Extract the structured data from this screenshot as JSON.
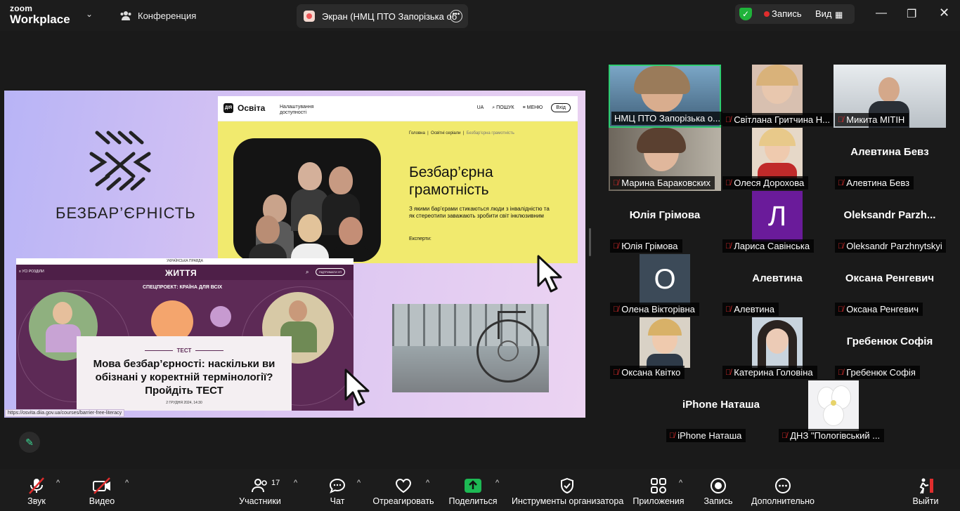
{
  "topbar": {
    "logo_line1": "zoom",
    "logo_line2": "Workplace",
    "conference_label": "Конференция",
    "share_tab_title": "Экран (НМЦ ПТО Запорізька об",
    "record_label": "Запись",
    "view_label": "Вид"
  },
  "slide": {
    "logo_text": "БЕЗБАР’ЄРНІСТЬ",
    "osvita": {
      "logo": "Освіта",
      "dia": "ДІЯ",
      "accessibility": "Налаштування доступності",
      "nav_ua": "UA",
      "nav_search": "ПОШУК",
      "nav_menu": "МЕНЮ",
      "nav_login": "Вхід",
      "breadcrumb_home": "Головна",
      "breadcrumb_series": "Освітні серіали",
      "breadcrumb_current": "Безбар'єрна грамотність",
      "title_line1": "Безбар’єрна",
      "title_line2": "грамотність",
      "subtitle": "З якими бар'єрами стикаються люди з інвалідністю та як стереотипи заважають зробити світ інклюзивним",
      "experts": "Експерти:"
    },
    "zhyttia": {
      "top_label": "УКРАЇНСЬКА ПРАВДА",
      "menu_label": "УСІ РОЗДІЛИ",
      "logo": "ЖИТТЯ",
      "support": "ПІДТРИМАТИ УП",
      "special": "СПЕЦПРОЕКТ: КРАЇНА ДЛЯ ВСІХ",
      "test_label": "ТЕСТ",
      "headline": "Мова безбар’єрності: наскільки ви обізнані у коректній термінології? Пройдіть ТЕСТ",
      "date": "2 ГРУДНЯ 2024, 14:30"
    },
    "url": "https://osvita.diia.gov.ua/courses/barrier-free-literacy"
  },
  "participants": [
    {
      "tile_name": "НМЦ ПТО Запорізька о...",
      "muted": false,
      "type": "video",
      "active": true
    },
    {
      "tile_name": "Світлана Гритчина Н...",
      "muted": true,
      "type": "photo"
    },
    {
      "tile_name": "Микита МІТІН",
      "muted": true,
      "type": "video"
    },
    {
      "tile_name": "Марина Бараковских",
      "muted": true,
      "type": "video"
    },
    {
      "tile_name": "Олеся Дорохова",
      "muted": true,
      "type": "photo"
    },
    {
      "tile_name": "Алевтина Бевз",
      "big_name": "Алевтина Бевз",
      "muted": true,
      "type": "name"
    },
    {
      "tile_name": "Юлія Грімова",
      "big_name": "Юлія Грімова",
      "muted": true,
      "type": "name"
    },
    {
      "tile_name": "Лариса Савінська",
      "muted": true,
      "type": "letter",
      "letter": "Л"
    },
    {
      "tile_name": "Oleksandr Parzhnytskyi",
      "big_name": "Oleksandr  Parzh...",
      "muted": true,
      "type": "name"
    },
    {
      "tile_name": "Олена Вікторівна",
      "muted": true,
      "type": "letter",
      "letter": "О"
    },
    {
      "tile_name": "Алевтина",
      "big_name": "Алевтина",
      "muted": true,
      "type": "name"
    },
    {
      "tile_name": "Оксана Ренгевич",
      "big_name": "Оксана Ренгевич",
      "muted": true,
      "type": "name"
    },
    {
      "tile_name": "Оксана Квітко",
      "muted": true,
      "type": "photo"
    },
    {
      "tile_name": "Катерина Головіна",
      "muted": true,
      "type": "photo"
    },
    {
      "tile_name": "Гребенюк Софія",
      "big_name": "Гребенюк Софія",
      "muted": true,
      "type": "name"
    },
    {
      "tile_name": "iPhone Наташа",
      "big_name": "iPhone Наташа",
      "muted": true,
      "type": "name"
    },
    {
      "tile_name": "ДНЗ \"Пологівський ...",
      "muted": true,
      "type": "photo"
    }
  ],
  "toolbar": {
    "audio": "Звук",
    "video": "Видео",
    "participants": "Участники",
    "participants_count": "17",
    "chat": "Чат",
    "react": "Отреагировать",
    "share": "Поделиться",
    "host_tools": "Инструменты организатора",
    "apps": "Приложения",
    "record": "Запись",
    "more": "Дополнительно",
    "leave": "Выйти"
  },
  "colors": {
    "accent_green": "#1fb33a",
    "record_red": "#e02d2d",
    "active_speaker": "#2ecc71",
    "share_green": "#1db954"
  }
}
